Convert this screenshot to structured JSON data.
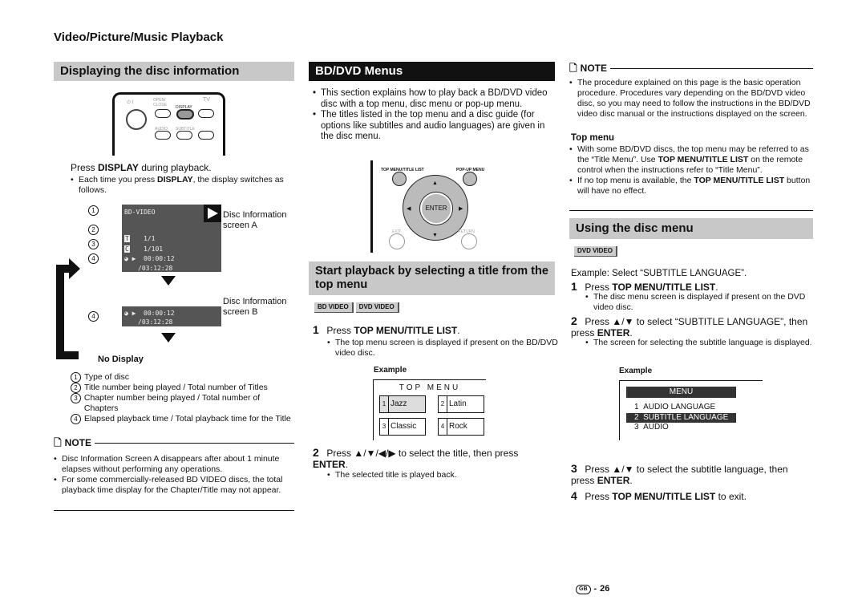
{
  "section_title": "Video/Picture/Music Playback",
  "col1": {
    "title": "Displaying the disc information",
    "remote": {
      "power": "⏻ I",
      "open_close": "OPEN/ CLOSE",
      "display": "DISPLAY",
      "tv": "TV",
      "audio": "AUDIO",
      "subtitle": "SUBTITLE"
    },
    "instruction_pre": "Press ",
    "instruction_bold": "DISPLAY",
    "instruction_post": " during playback.",
    "bullet_pre": "Each time you press ",
    "bullet_bold": "DISPLAY",
    "bullet_post": ", the display switches as follows.",
    "screen_a": {
      "disc": "BD-VIDEO",
      "title": "1/1",
      "chapter": "1/101",
      "elapsed": "00:00:12",
      "total": "/03:12:28",
      "label": "Disc Information screen A"
    },
    "screen_b": {
      "elapsed": "00:00:12",
      "total": "/03:12:28",
      "label": "Disc Information screen B"
    },
    "no_display": "No Display",
    "markers": [
      "1",
      "2",
      "3",
      "4"
    ],
    "legend": [
      "Type of disc",
      "Title number being played / Total number of Titles",
      "Chapter number being played / Total number of Chapters",
      "Elapsed playback time / Total playback time for the Title"
    ],
    "note_label": "NOTE",
    "notes": [
      "Disc Information Screen A disappears after about 1 minute elapses without performing any operations.",
      "For some commercially-released BD VIDEO discs, the total playback time display for the Chapter/Title may not appear."
    ]
  },
  "col2": {
    "title": "BD/DVD Menus",
    "bullets": [
      "This section explains how to play back a BD/DVD video disc with a top menu, disc menu or pop-up menu.",
      "The titles listed in the top menu and a disc guide (for options like subtitles and audio languages) are given in the disc menu."
    ],
    "remote": {
      "top_menu": "TOP MENU/TITLE LIST",
      "popup": "POP-UP MENU",
      "enter": "ENTER",
      "exit": "EXIT",
      "return": "RETURN"
    },
    "subtitle": "Start playback by selecting a title from the top menu",
    "badges": [
      "BD VIDEO",
      "DVD VIDEO"
    ],
    "step1": {
      "n": "1",
      "pre": "Press ",
      "bold": "TOP MENU/TITLE LIST",
      "post": ".",
      "bullet": "The top menu screen is displayed if present on the BD/DVD video disc."
    },
    "example_label": "Example",
    "top_menu": {
      "heading": "TOP MENU",
      "items": [
        {
          "n": "1",
          "label": "Jazz"
        },
        {
          "n": "2",
          "label": "Latin"
        },
        {
          "n": "3",
          "label": "Classic"
        },
        {
          "n": "4",
          "label": "Rock"
        }
      ]
    },
    "step2": {
      "n": "2",
      "pre": "Press ▲/▼/◀/▶ to select the title, then press ",
      "bold": "ENTER",
      "post": ".",
      "bullet": "The selected title is played back."
    }
  },
  "col3": {
    "note_label": "NOTE",
    "note": "The procedure explained on this page is the basic operation procedure. Procedures vary depending on the BD/DVD video disc, so you may need to follow the instructions in the BD/DVD video disc manual or the instructions displayed on the screen.",
    "top_menu_heading": "Top menu",
    "tm_b1_pre": "With some BD/DVD discs, the top menu may be referred to as the “Title Menu”. Use ",
    "tm_b1_bold": "TOP MENU/TITLE LIST",
    "tm_b1_post": " on the remote control when the instructions refer to “Title Menu”.",
    "tm_b2_pre": "If no top menu is available, the ",
    "tm_b2_bold": "TOP MENU/TITLE LIST",
    "tm_b2_post": " button will have no effect.",
    "title": "Using the disc menu",
    "badge": "DVD VIDEO",
    "example_intro": "Example: Select “SUBTITLE LANGUAGE”.",
    "step1": {
      "n": "1",
      "pre": "Press ",
      "bold": "TOP MENU/TITLE LIST",
      "post": ".",
      "bullet": "The disc menu screen is displayed if present on the DVD video disc."
    },
    "step2": {
      "n": "2",
      "pre": "Press ▲/▼ to select “SUBTITLE LANGUAGE”, then press ",
      "bold": "ENTER",
      "post": ".",
      "bullet": "The screen for selecting the subtitle language is displayed."
    },
    "example_label": "Example",
    "menu": {
      "heading": "MENU",
      "items": [
        {
          "n": "1",
          "label": "AUDIO LANGUAGE"
        },
        {
          "n": "2",
          "label": "SUBTITLE LANGUAGE"
        },
        {
          "n": "3",
          "label": "AUDIO"
        }
      ],
      "selected": "2"
    },
    "step3": {
      "n": "3",
      "pre": "Press ▲/▼ to select the subtitle language, then press ",
      "bold": "ENTER",
      "post": "."
    },
    "step4": {
      "n": "4",
      "pre": "Press ",
      "bold": "TOP MENU/TITLE LIST",
      "post": " to exit."
    }
  },
  "footer": {
    "region": "GB",
    "page": "26"
  }
}
